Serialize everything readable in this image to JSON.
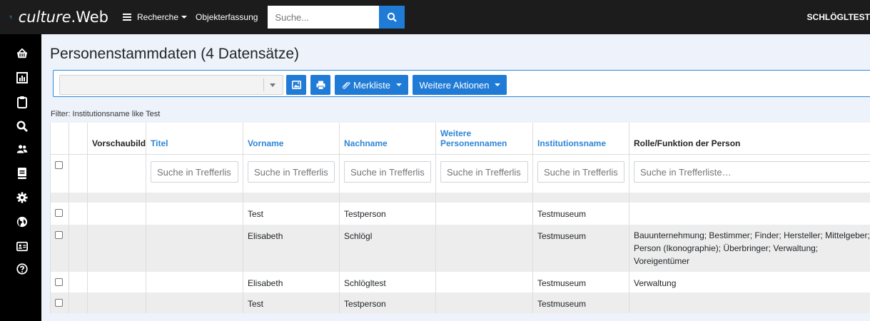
{
  "app": {
    "brand_prefix": "culture",
    "brand_suffix": ".Web",
    "nav": {
      "recherche": "Recherche",
      "objekterfassung": "Objekterfassung"
    },
    "search": {
      "placeholder": "Suche..."
    },
    "user": "SCHLÖGLTEST"
  },
  "sidebar": {
    "icons": [
      "basket-icon",
      "chart-icon",
      "clipboard-icon",
      "search-icon",
      "users-icon",
      "book-icon",
      "gear-icon",
      "globe-icon",
      "id-card-icon",
      "help-icon"
    ]
  },
  "page": {
    "title": "Personenstammdaten (4 Datensätze)",
    "filter": "Filter: Institutionsname like Test"
  },
  "toolbar": {
    "merkliste": "Merkliste",
    "weitere_aktionen": "Weitere Aktionen"
  },
  "table": {
    "headers": {
      "vorschaubild": "Vorschaubild",
      "titel": "Titel",
      "vorname": "Vorname",
      "nachname": "Nachname",
      "weitere_line1": "Weitere",
      "weitere_line2": "Personennamen",
      "institutionsname": "Institutionsname",
      "rolle": "Rolle/Funktion der Person"
    },
    "search_placeholder_short": "Suche in Trefferlis",
    "search_placeholder_full": "Suche in Trefferliste…",
    "rows": [
      {
        "titel": "",
        "vorname": "Test",
        "nachname": "Testperson",
        "weitere": "",
        "institution": "Testmuseum",
        "rolle": ""
      },
      {
        "titel": "",
        "vorname": "Elisabeth",
        "nachname": "Schlögl",
        "weitere": "",
        "institution": "Testmuseum",
        "rolle_line1": "Bauunternehmung; Bestimmer; Finder; Hersteller; Mittelgeber;",
        "rolle_line2": "Person (Ikonographie); Überbringer; Verwaltung;",
        "rolle_line3": "Voreigentümer"
      },
      {
        "titel": "",
        "vorname": "Elisabeth",
        "nachname": "Schlögltest",
        "weitere": "",
        "institution": "Testmuseum",
        "rolle": "Verwaltung"
      },
      {
        "titel": "",
        "vorname": "Test",
        "nachname": "Testperson",
        "weitere": "",
        "institution": "Testmuseum",
        "rolle": ""
      }
    ]
  },
  "colors": {
    "accent": "#1f7bd6",
    "link": "#2f86d6",
    "sidebar": "#000000",
    "topbar": "#1c1c1c"
  }
}
